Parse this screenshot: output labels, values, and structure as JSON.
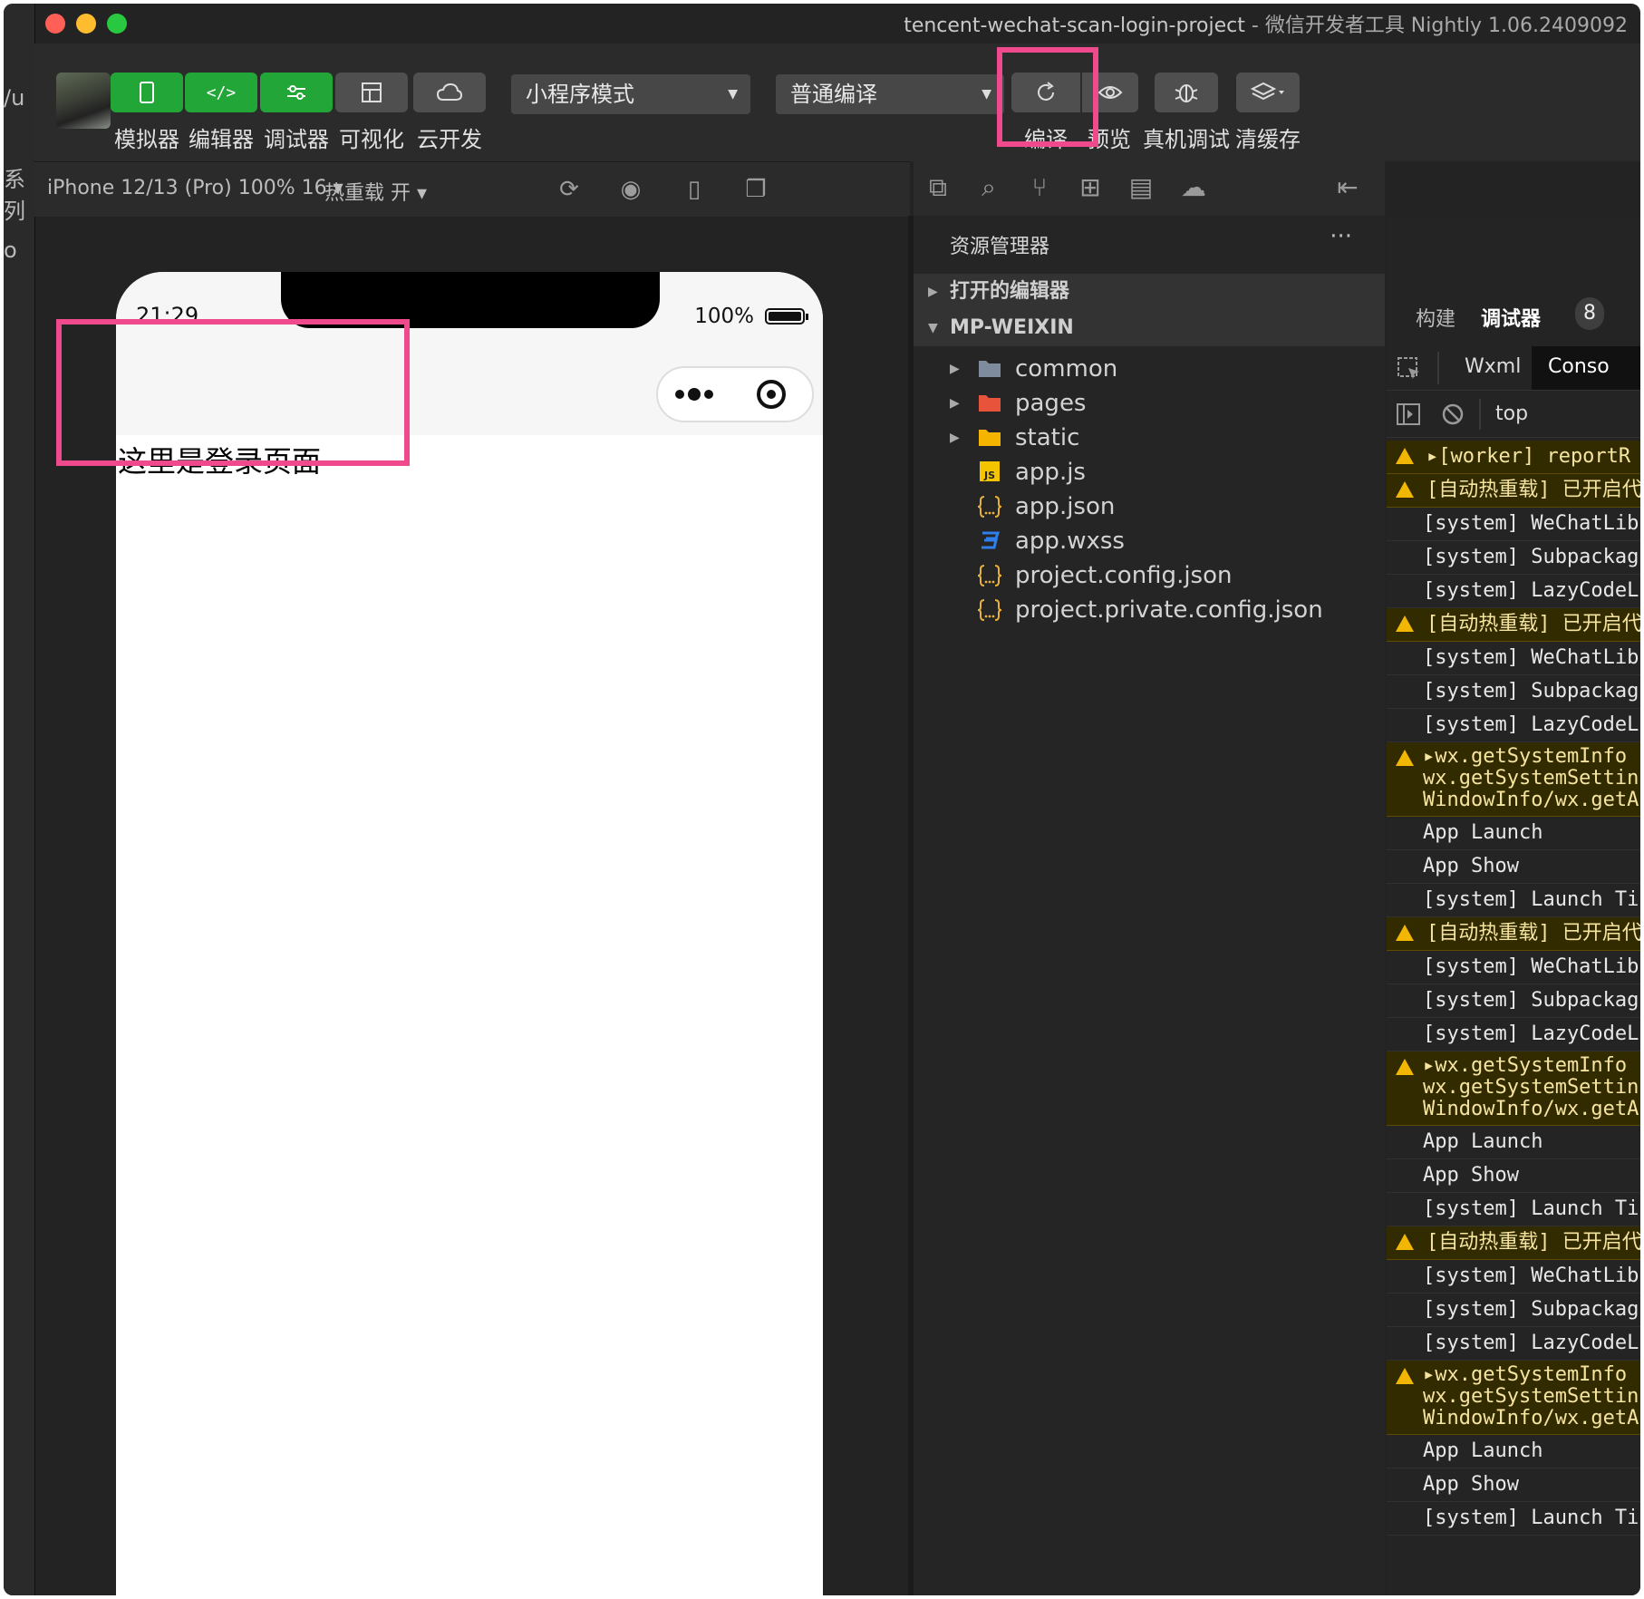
{
  "window": {
    "project": "tencent-wechat-scan-login-project",
    "separator": "-",
    "app": "微信开发者工具 Nightly 1.06.2409092"
  },
  "edge": {
    "t1": "/u",
    "t2": "系列",
    "t3": "o"
  },
  "toolbar": {
    "simulator": "模拟器",
    "editor": "编辑器",
    "debugger": "调试器",
    "visual": "可视化",
    "cloud": "云开发",
    "mode": "小程序模式",
    "compile_mode": "普通编译",
    "compile": "编译",
    "preview": "预览",
    "real_debug": "真机调试",
    "clear_cache": "清缓存"
  },
  "simulator": {
    "device": "iPhone 12/13 (Pro) 100% 16 ▾",
    "hot_reload": "热重载 开 ▾"
  },
  "phone": {
    "time": "21:29",
    "battery": "100%",
    "page_text": "这里是登录页面"
  },
  "explorer": {
    "title": "资源管理器",
    "more": "···",
    "open_editors": "打开的编辑器",
    "root": "MP-WEIXIN",
    "files": [
      {
        "name": "common",
        "icon": "folder-icon",
        "color": "#7e8c9d"
      },
      {
        "name": "pages",
        "icon": "folder-pages-icon",
        "color": "#e8533b"
      },
      {
        "name": "static",
        "icon": "folder-static-icon",
        "color": "#f4b400"
      },
      {
        "name": "app.js",
        "icon": "js-icon",
        "color": "#f5c400"
      },
      {
        "name": "app.json",
        "icon": "json-icon",
        "color": "#e8b23a"
      },
      {
        "name": "app.wxss",
        "icon": "css-icon",
        "color": "#2f80ed"
      },
      {
        "name": "project.config.json",
        "icon": "json-icon",
        "color": "#e8b23a"
      },
      {
        "name": "project.private.config.json",
        "icon": "json-icon",
        "color": "#e8b23a"
      }
    ]
  },
  "devtools": {
    "tab_build": "构建",
    "tab_debugger": "调试器",
    "badge": "8",
    "tab_wxml": "Wxml",
    "tab_console": "Conso",
    "context": "top",
    "logs": [
      "▸[worker] reportR",
      "[自动热重载] 已开启代",
      "[system] WeChatLib",
      "[system] Subpackag",
      "[system] LazyCodeL",
      "[自动热重载] 已开启代",
      "[system] WeChatLib",
      "[system] Subpackag",
      "[system] LazyCodeL",
      "▸wx.getSystemInfo\nwx.getSystemSettin\nWindowInfo/wx.getA",
      "App Launch",
      "App Show",
      "[system] Launch Ti",
      "[自动热重载] 已开启代",
      "[system] WeChatLib",
      "[system] Subpackag",
      "[system] LazyCodeL",
      "▸wx.getSystemInfo\nwx.getSystemSettin\nWindowInfo/wx.getA",
      "App Launch",
      "App Show",
      "[system] Launch Ti",
      "[自动热重载] 已开启代",
      "[system] WeChatLib",
      "[system] Subpackag",
      "[system] LazyCodeL",
      "▸wx.getSystemInfo\nwx.getSystemSettin\nWindowInfo/wx.getA",
      "App Launch",
      "App Show",
      "[system] Launch Ti"
    ]
  }
}
